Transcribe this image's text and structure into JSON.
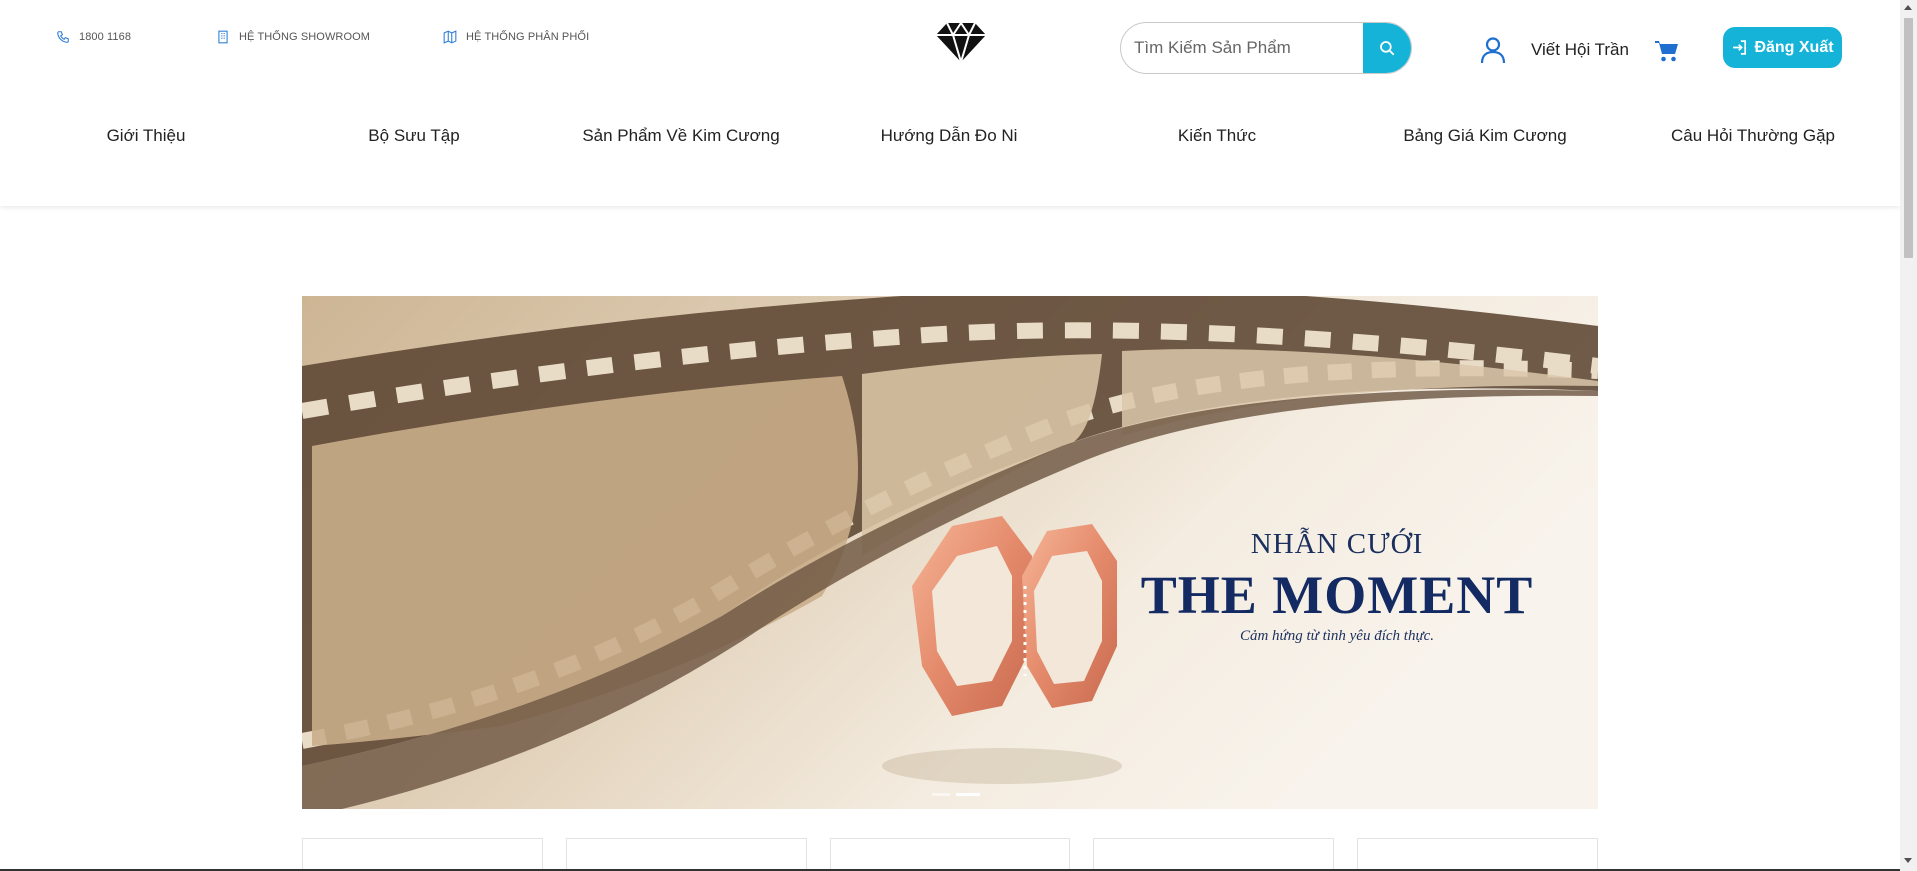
{
  "topbar": {
    "phone": "1800 1168",
    "showroom": "HỆ THỐNG SHOWROOM",
    "distribution": "HỆ THỐNG PHÂN PHỐI"
  },
  "search": {
    "placeholder": "Tìm Kiếm Sản Phẩm",
    "value": ""
  },
  "user": {
    "name": "Viết Hội Trần"
  },
  "logout_label": "Đăng Xuất",
  "nav": [
    "Giới Thiệu",
    "Bộ Sưu Tập",
    "Sản Phẩm Về Kim Cương",
    "Hướng Dẫn Đo Ni",
    "Kiến Thức",
    "Bảng Giá Kim Cương",
    "Câu Hỏi Thường Gặp"
  ],
  "banner": {
    "line1": "NHẪN CƯỚI",
    "line2": "THE MOMENT",
    "line3": "Cảm hứng từ tình yêu đích thực."
  },
  "colors": {
    "accent": "#16b3d8",
    "banner_text": "#132a63",
    "icon_blue": "#1e6fd0"
  },
  "icons": [
    "phone-icon",
    "showroom-icon",
    "map-icon",
    "diamond-logo",
    "search-icon",
    "user-icon",
    "cart-icon",
    "logout-icon"
  ]
}
